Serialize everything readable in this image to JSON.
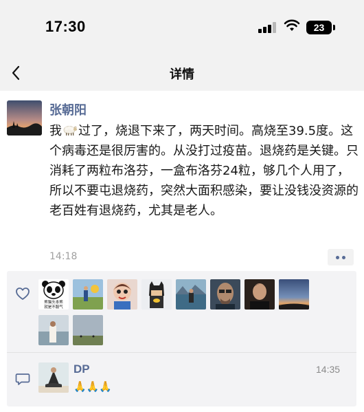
{
  "status_bar": {
    "time": "17:30",
    "battery": "23"
  },
  "nav": {
    "title": "详情"
  },
  "post": {
    "author": "张朝阳",
    "text_before_emoji": "我",
    "emoji": "sheep-emoji",
    "text_after_emoji": "过了，烧退下来了，两天时间。高烧至39.5度。这个病毒还是很厉害的。从没打过疫苗。退烧药是关键。只消耗了两粒布洛芬，一盒布洛芬24粒，够几个人用了，所以不要屯退烧药，突然大面积感染，要让没钱没资源的老百姓有退烧药，尤其是老人。",
    "time": "14:18"
  },
  "likes": {
    "icon": "heart-icon",
    "panda_caption_1": "熊猫头本熊",
    "panda_caption_2": "就是不服气"
  },
  "comments": [
    {
      "author": "DP",
      "time": "14:35",
      "text": "🙏🙏🙏"
    }
  ],
  "colors": {
    "link_blue": "#576b95",
    "background": "#f2f2f2"
  }
}
